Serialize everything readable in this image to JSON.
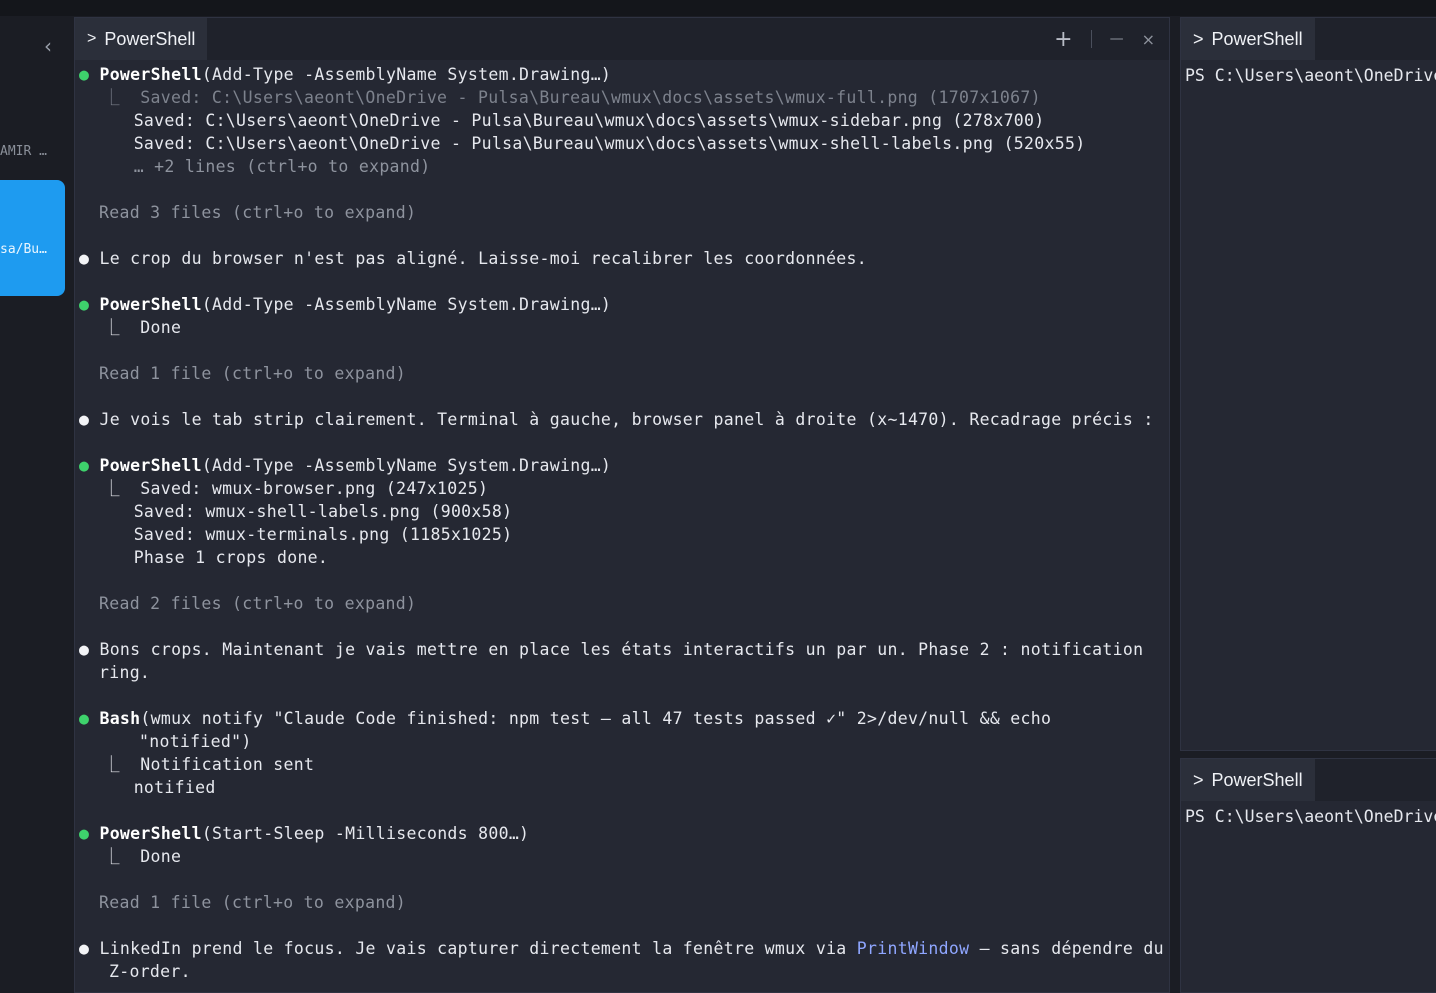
{
  "sidebar": {
    "collapse_glyph": "‹",
    "workspace_label": "AMIR …",
    "workspace_card_path": "sa/Bu…"
  },
  "main_pane": {
    "tab_label": "PowerShell",
    "tab_chevron": ">",
    "actions": {
      "new": "+",
      "minimize": "—",
      "close": "×"
    }
  },
  "transcript": {
    "l1_dot": "●",
    "l1_name": "PowerShell",
    "l1_args": "(Add-Type -AssemblyName System.Drawing…)",
    "l2": "⎿  Saved: C:\\Users\\aeont\\OneDrive - Pulsa\\Bureau\\wmux\\docs\\assets\\wmux-full.png (1707x1067)",
    "l3": "   Saved: C:\\Users\\aeont\\OneDrive - Pulsa\\Bureau\\wmux\\docs\\assets\\wmux-sidebar.png (278x700)",
    "l4": "   Saved: C:\\Users\\aeont\\OneDrive - Pulsa\\Bureau\\wmux\\docs\\assets\\wmux-shell-labels.png (520x55)",
    "l5": "   … +2 lines (ctrl+o to expand)",
    "l6": "Read 3 files (ctrl+o to expand)",
    "l7_dot": "●",
    "l7": "Le crop du browser n'est pas aligné. Laisse-moi recalibrer les coordonnées.",
    "l8_dot": "●",
    "l8_name": "PowerShell",
    "l8_args": "(Add-Type -AssemblyName System.Drawing…)",
    "l9": "⎿  Done",
    "l10": "Read 1 file (ctrl+o to expand)",
    "l11_dot": "●",
    "l11": "Je vois le tab strip clairement. Terminal à gauche, browser panel à droite (x~1470). Recadrage précis :",
    "l12_dot": "●",
    "l12_name": "PowerShell",
    "l12_args": "(Add-Type -AssemblyName System.Drawing…)",
    "l13": "⎿  Saved: wmux-browser.png (247x1025)",
    "l14": "   Saved: wmux-shell-labels.png (900x58)",
    "l15": "   Saved: wmux-terminals.png (1185x1025)",
    "l16": "   Phase 1 crops done.",
    "l17": "Read 2 files (ctrl+o to expand)",
    "l18_dot": "●",
    "l18": "Bons crops. Maintenant je vais mettre en place les états interactifs un par un. Phase 2 : notification",
    "l19": "ring.",
    "l20_dot": "●",
    "l20_name": "Bash",
    "l20_args": "(wmux notify \"Claude Code finished: npm test — all 47 tests passed ✓\" 2>/dev/null && echo",
    "l21": "\"notified\")",
    "l22": "⎿  Notification sent",
    "l23": "   notified",
    "l24_dot": "●",
    "l24_name": "PowerShell",
    "l24_args": "(Start-Sleep -Milliseconds 800…)",
    "l25": "⎿  Done",
    "l26": "Read 1 file (ctrl+o to expand)",
    "l27_dot": "●",
    "l27_a": "LinkedIn prend le focus. Je vais capturer directement la fenêtre wmux via ",
    "l27_link": "PrintWindow",
    "l27_b": " — sans dépendre du",
    "l28": "Z-order."
  },
  "right_top": {
    "tab_label": "PowerShell",
    "tab_chevron": ">",
    "prompt": "PS C:\\Users\\aeont\\OneDrive"
  },
  "right_bottom": {
    "tab_label": "PowerShell",
    "tab_chevron": ">",
    "prompt": "PS C:\\Users\\aeont\\OneDrive"
  },
  "colors": {
    "accent": "#1e9bf0",
    "status_dot": "#3ed26c",
    "link": "#8fa6ff",
    "pane_bg": "#252833"
  }
}
